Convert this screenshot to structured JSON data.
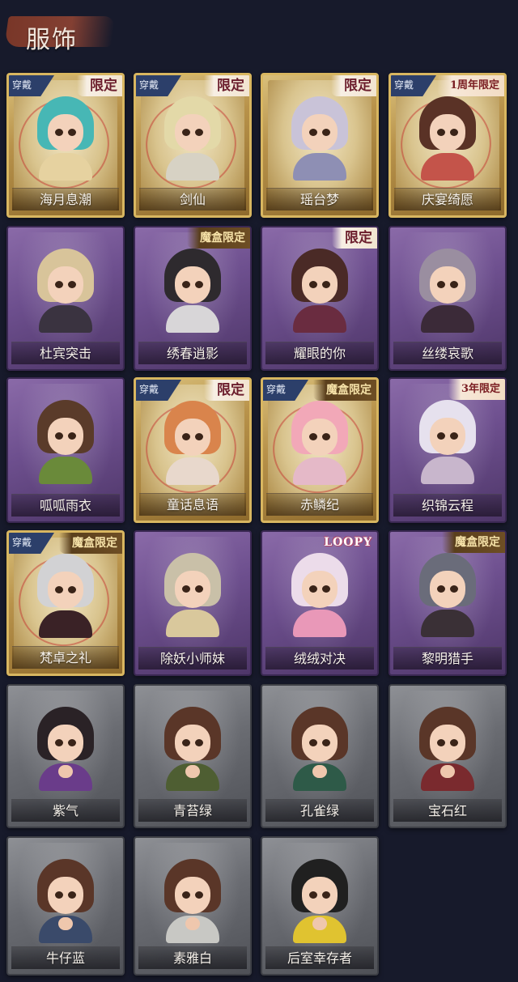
{
  "header": {
    "title": "服饰"
  },
  "tags": {
    "equipped": "穿戴"
  },
  "outfits": [
    {
      "name": "海月息潮",
      "frame": "gold",
      "equipped": true,
      "badge": "限定",
      "badge_style": "limited",
      "hair": "#47b7b5",
      "outfit": "#e6d2a0"
    },
    {
      "name": "剑仙",
      "frame": "gold",
      "equipped": true,
      "badge": "限定",
      "badge_style": "limited",
      "hair": "#e3d9a8",
      "outfit": "#d7d2c4"
    },
    {
      "name": "瑶台梦",
      "frame": "gold",
      "equipped": false,
      "badge": "限定",
      "badge_style": "limited",
      "hair": "#c9c3d8",
      "outfit": "#8e8fb4"
    },
    {
      "name": "庆宴绮愿",
      "frame": "gold",
      "equipped": true,
      "badge": "1周年限定",
      "badge_style": "ann",
      "hair": "#5a3226",
      "outfit": "#c4544a"
    },
    {
      "name": "杜宾突击",
      "frame": "purple",
      "equipped": false,
      "badge": "",
      "badge_style": "",
      "hair": "#d8c49a",
      "outfit": "#3a3340"
    },
    {
      "name": "绣春逍影",
      "frame": "purple",
      "equipped": false,
      "badge": "魔盒限定",
      "badge_style": "box",
      "hair": "#2e2a2e",
      "outfit": "#d8d6d8"
    },
    {
      "name": "耀眼的你",
      "frame": "purple",
      "equipped": false,
      "badge": "限定",
      "badge_style": "limited",
      "hair": "#4a2a26",
      "outfit": "#6a2c40"
    },
    {
      "name": "丝缕哀歌",
      "frame": "purple",
      "equipped": false,
      "badge": "",
      "badge_style": "",
      "hair": "#9a8ea0",
      "outfit": "#3b2a38"
    },
    {
      "name": "呱呱雨衣",
      "frame": "purple",
      "equipped": false,
      "badge": "",
      "badge_style": "",
      "hair": "#5a3b2a",
      "outfit": "#6a8a3a"
    },
    {
      "name": "童话息语",
      "frame": "gold",
      "equipped": true,
      "badge": "限定",
      "badge_style": "limited",
      "hair": "#d9844c",
      "outfit": "#e8d8cc"
    },
    {
      "name": "赤鳞纪",
      "frame": "gold",
      "equipped": true,
      "badge": "魔盒限定",
      "badge_style": "box",
      "hair": "#f2a8b8",
      "outfit": "#e5b9c8"
    },
    {
      "name": "织锦云程",
      "frame": "purple",
      "equipped": false,
      "badge": "3年限定",
      "badge_style": "ann",
      "hair": "#e6e1ee",
      "outfit": "#c8b6cc"
    },
    {
      "name": "梵卓之礼",
      "frame": "gold",
      "equipped": true,
      "badge": "魔盒限定",
      "badge_style": "box",
      "hair": "#d2d2d4",
      "outfit": "#3a2226"
    },
    {
      "name": "除妖小师妹",
      "frame": "purple",
      "equipped": false,
      "badge": "",
      "badge_style": "",
      "hair": "#c9c0a8",
      "outfit": "#d9c89c"
    },
    {
      "name": "绒绒对决",
      "frame": "purple",
      "equipped": false,
      "badge": "LOOPY",
      "badge_style": "logo",
      "hair": "#ecdcea",
      "outfit": "#e998b8"
    },
    {
      "name": "黎明猎手",
      "frame": "purple",
      "equipped": false,
      "badge": "魔盒限定",
      "badge_style": "box",
      "hair": "#6a6c7a",
      "outfit": "#3a3036"
    },
    {
      "name": "紫气",
      "frame": "gray",
      "equipped": false,
      "badge": "",
      "badge_style": "",
      "hair": "#2a2226",
      "outfit": "#6a3c8a"
    },
    {
      "name": "青苔绿",
      "frame": "gray",
      "equipped": false,
      "badge": "",
      "badge_style": "",
      "hair": "#5a3628",
      "outfit": "#4e5e32"
    },
    {
      "name": "孔雀绿",
      "frame": "gray",
      "equipped": false,
      "badge": "",
      "badge_style": "",
      "hair": "#5a3628",
      "outfit": "#2e5a48"
    },
    {
      "name": "宝石红",
      "frame": "gray",
      "equipped": false,
      "badge": "",
      "badge_style": "",
      "hair": "#5a3628",
      "outfit": "#7a2a2e"
    },
    {
      "name": "牛仔蓝",
      "frame": "gray",
      "equipped": false,
      "badge": "",
      "badge_style": "",
      "hair": "#5a3628",
      "outfit": "#3a4a6a"
    },
    {
      "name": "素雅白",
      "frame": "gray",
      "equipped": false,
      "badge": "",
      "badge_style": "",
      "hair": "#5a3628",
      "outfit": "#c8c8c4"
    },
    {
      "name": "后室幸存者",
      "frame": "gray",
      "equipped": false,
      "badge": "",
      "badge_style": "",
      "hair": "#202020",
      "outfit": "#e0c330"
    }
  ]
}
